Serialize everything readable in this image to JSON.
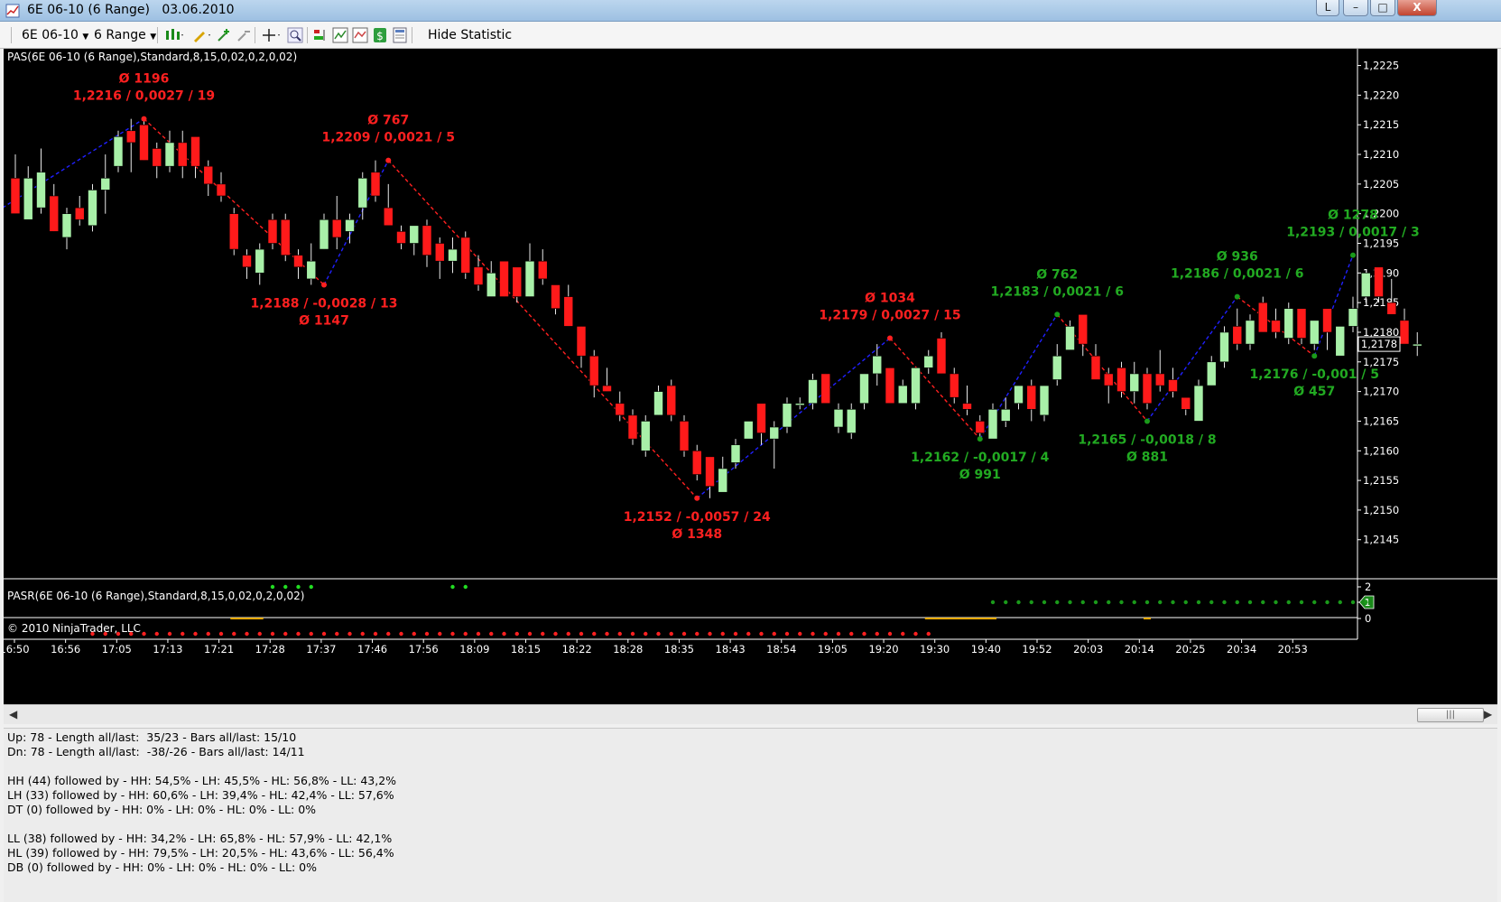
{
  "window": {
    "title": "6E 06-10 (6 Range)",
    "date": "03.06.2010",
    "minimize_label": "–",
    "maximize_label": "□",
    "close_label": "X"
  },
  "toolbar": {
    "instrument": "6E 06-10",
    "period": "6 Range",
    "hide_statistic_label": "Hide Statistic"
  },
  "chart": {
    "indicator_label": "PAS(6E 06-10 (6 Range),Standard,8,15,0,02,0,2,0,02)",
    "subpanel_label": "PASR(6E 06-10 (6 Range),Standard,8,15,0,02,0,2,0,02)",
    "copyright": "© 2010 NinjaTrader, LLC",
    "current_price": "1,2178",
    "subpanel_axis": [
      "2",
      "1",
      "0"
    ],
    "subpanel_value_badge": "1",
    "colors": {
      "up": "#a8f0a8",
      "down": "#ff1a1a",
      "blue_leg": "#2020ff",
      "red_leg": "#ff2020",
      "green_text": "#22aa22"
    }
  },
  "chart_data": {
    "type": "candlestick",
    "ylim": [
      1.2141,
      1.2226
    ],
    "y_ticks": [
      "1,2225",
      "1,2220",
      "1,2215",
      "1,2210",
      "1,2205",
      "1,2200",
      "1,2195",
      "1,2190",
      "1,2185",
      "1,2180",
      "1,2175",
      "1,2170",
      "1,2165",
      "1,2160",
      "1,2155",
      "1,2150",
      "1,2145"
    ],
    "x_ticks": [
      "16:50",
      "16:56",
      "17:05",
      "17:13",
      "17:21",
      "17:28",
      "17:37",
      "17:46",
      "17:56",
      "18:09",
      "18:15",
      "18:22",
      "18:28",
      "18:35",
      "18:43",
      "18:54",
      "19:05",
      "19:20",
      "19:30",
      "19:40",
      "19:52",
      "20:03",
      "20:14",
      "20:25",
      "20:34",
      "20:53"
    ],
    "candles": [
      {
        "o": 1.2206,
        "c": 1.22,
        "h": 1.221,
        "l": 1.22
      },
      {
        "o": 1.2199,
        "c": 1.2206,
        "h": 1.2208,
        "l": 1.2199
      },
      {
        "o": 1.2201,
        "c": 1.2207,
        "h": 1.2211,
        "l": 1.22
      },
      {
        "o": 1.2203,
        "c": 1.2197,
        "h": 1.2205,
        "l": 1.2197
      },
      {
        "o": 1.2196,
        "c": 1.22,
        "h": 1.2201,
        "l": 1.2194
      },
      {
        "o": 1.2201,
        "c": 1.2199,
        "h": 1.2203,
        "l": 1.2198
      },
      {
        "o": 1.2198,
        "c": 1.2204,
        "h": 1.2205,
        "l": 1.2197
      },
      {
        "o": 1.2204,
        "c": 1.2206,
        "h": 1.221,
        "l": 1.22
      },
      {
        "o": 1.2208,
        "c": 1.2213,
        "h": 1.2214,
        "l": 1.2207
      },
      {
        "o": 1.2214,
        "c": 1.2212,
        "h": 1.2216,
        "l": 1.2207
      },
      {
        "o": 1.2215,
        "c": 1.2209,
        "h": 1.2216,
        "l": 1.2209
      },
      {
        "o": 1.2211,
        "c": 1.2208,
        "h": 1.2212,
        "l": 1.2206
      },
      {
        "o": 1.2208,
        "c": 1.2212,
        "h": 1.2214,
        "l": 1.2207
      },
      {
        "o": 1.2212,
        "c": 1.2208,
        "h": 1.2214,
        "l": 1.2206
      },
      {
        "o": 1.2213,
        "c": 1.2208,
        "h": 1.2213,
        "l": 1.2206
      },
      {
        "o": 1.2208,
        "c": 1.2205,
        "h": 1.2209,
        "l": 1.2203
      },
      {
        "o": 1.2205,
        "c": 1.2203,
        "h": 1.2207,
        "l": 1.2202
      },
      {
        "o": 1.22,
        "c": 1.2194,
        "h": 1.2201,
        "l": 1.2193
      },
      {
        "o": 1.2193,
        "c": 1.2191,
        "h": 1.2194,
        "l": 1.2189
      },
      {
        "o": 1.219,
        "c": 1.2194,
        "h": 1.2195,
        "l": 1.2188
      },
      {
        "o": 1.2199,
        "c": 1.2195,
        "h": 1.22,
        "l": 1.2194
      },
      {
        "o": 1.2199,
        "c": 1.2193,
        "h": 1.22,
        "l": 1.2192
      },
      {
        "o": 1.2193,
        "c": 1.2191,
        "h": 1.2194,
        "l": 1.2189
      },
      {
        "o": 1.2189,
        "c": 1.2192,
        "h": 1.2195,
        "l": 1.2188
      },
      {
        "o": 1.2194,
        "c": 1.2199,
        "h": 1.22,
        "l": 1.2194
      },
      {
        "o": 1.2199,
        "c": 1.2196,
        "h": 1.2203,
        "l": 1.2194
      },
      {
        "o": 1.2197,
        "c": 1.2199,
        "h": 1.22,
        "l": 1.2195
      },
      {
        "o": 1.2201,
        "c": 1.2206,
        "h": 1.2207,
        "l": 1.2199
      },
      {
        "o": 1.2207,
        "c": 1.2203,
        "h": 1.2209,
        "l": 1.2202
      },
      {
        "o": 1.2201,
        "c": 1.2198,
        "h": 1.2205,
        "l": 1.2198
      },
      {
        "o": 1.2197,
        "c": 1.2195,
        "h": 1.2198,
        "l": 1.2194
      },
      {
        "o": 1.2195,
        "c": 1.2198,
        "h": 1.2198,
        "l": 1.2193
      },
      {
        "o": 1.2198,
        "c": 1.2193,
        "h": 1.2199,
        "l": 1.2191
      },
      {
        "o": 1.2195,
        "c": 1.2192,
        "h": 1.2196,
        "l": 1.2189
      },
      {
        "o": 1.2192,
        "c": 1.2194,
        "h": 1.2196,
        "l": 1.219
      },
      {
        "o": 1.2196,
        "c": 1.219,
        "h": 1.2197,
        "l": 1.2189
      },
      {
        "o": 1.2191,
        "c": 1.2188,
        "h": 1.2193,
        "l": 1.2187
      },
      {
        "o": 1.2186,
        "c": 1.219,
        "h": 1.2192,
        "l": 1.2186
      },
      {
        "o": 1.2192,
        "c": 1.2186,
        "h": 1.2192,
        "l": 1.2186
      },
      {
        "o": 1.2191,
        "c": 1.2186,
        "h": 1.2191,
        "l": 1.2185
      },
      {
        "o": 1.2186,
        "c": 1.2192,
        "h": 1.2195,
        "l": 1.2186
      },
      {
        "o": 1.2192,
        "c": 1.2189,
        "h": 1.2194,
        "l": 1.2188
      },
      {
        "o": 1.2188,
        "c": 1.2184,
        "h": 1.2188,
        "l": 1.2183
      },
      {
        "o": 1.2186,
        "c": 1.2181,
        "h": 1.2188,
        "l": 1.2181
      },
      {
        "o": 1.2181,
        "c": 1.2176,
        "h": 1.2181,
        "l": 1.2174
      },
      {
        "o": 1.2176,
        "c": 1.2171,
        "h": 1.2177,
        "l": 1.2169
      },
      {
        "o": 1.2171,
        "c": 1.217,
        "h": 1.2174,
        "l": 1.217
      },
      {
        "o": 1.2168,
        "c": 1.2166,
        "h": 1.217,
        "l": 1.2165
      },
      {
        "o": 1.2166,
        "c": 1.2162,
        "h": 1.2167,
        "l": 1.2161
      },
      {
        "o": 1.216,
        "c": 1.2165,
        "h": 1.2166,
        "l": 1.2159
      },
      {
        "o": 1.2166,
        "c": 1.217,
        "h": 1.2171,
        "l": 1.2166
      },
      {
        "o": 1.2171,
        "c": 1.2166,
        "h": 1.2172,
        "l": 1.2165
      },
      {
        "o": 1.2165,
        "c": 1.216,
        "h": 1.2166,
        "l": 1.2159
      },
      {
        "o": 1.216,
        "c": 1.2156,
        "h": 1.2161,
        "l": 1.2155
      },
      {
        "o": 1.2159,
        "c": 1.2154,
        "h": 1.2159,
        "l": 1.2152
      },
      {
        "o": 1.2153,
        "c": 1.2157,
        "h": 1.2159,
        "l": 1.2153
      },
      {
        "o": 1.2158,
        "c": 1.2161,
        "h": 1.2162,
        "l": 1.2157
      },
      {
        "o": 1.2162,
        "c": 1.2165,
        "h": 1.2165,
        "l": 1.2162
      },
      {
        "o": 1.2168,
        "c": 1.2163,
        "h": 1.2168,
        "l": 1.2161
      },
      {
        "o": 1.2162,
        "c": 1.2164,
        "h": 1.2165,
        "l": 1.2157
      },
      {
        "o": 1.2164,
        "c": 1.2168,
        "h": 1.2169,
        "l": 1.2163
      },
      {
        "o": 1.2168,
        "c": 1.2168,
        "h": 1.2169,
        "l": 1.2167
      },
      {
        "o": 1.2168,
        "c": 1.2172,
        "h": 1.2173,
        "l": 1.2167
      },
      {
        "o": 1.2173,
        "c": 1.2168,
        "h": 1.2173,
        "l": 1.2168
      },
      {
        "o": 1.2164,
        "c": 1.2167,
        "h": 1.2168,
        "l": 1.2163
      },
      {
        "o": 1.2163,
        "c": 1.2167,
        "h": 1.2168,
        "l": 1.2162
      },
      {
        "o": 1.2168,
        "c": 1.2173,
        "h": 1.2173,
        "l": 1.2167
      },
      {
        "o": 1.2173,
        "c": 1.2176,
        "h": 1.2178,
        "l": 1.2171
      },
      {
        "o": 1.2174,
        "c": 1.2168,
        "h": 1.2174,
        "l": 1.2168
      },
      {
        "o": 1.2168,
        "c": 1.2171,
        "h": 1.2172,
        "l": 1.2168
      },
      {
        "o": 1.2168,
        "c": 1.2174,
        "h": 1.2174,
        "l": 1.2167
      },
      {
        "o": 1.2174,
        "c": 1.2176,
        "h": 1.2177,
        "l": 1.2173
      },
      {
        "o": 1.2179,
        "c": 1.2173,
        "h": 1.218,
        "l": 1.2173
      },
      {
        "o": 1.2173,
        "c": 1.2169,
        "h": 1.2174,
        "l": 1.2168
      },
      {
        "o": 1.2168,
        "c": 1.2167,
        "h": 1.2171,
        "l": 1.2166
      },
      {
        "o": 1.2165,
        "c": 1.2163,
        "h": 1.2166,
        "l": 1.2162
      },
      {
        "o": 1.2162,
        "c": 1.2167,
        "h": 1.2168,
        "l": 1.2162
      },
      {
        "o": 1.2165,
        "c": 1.2167,
        "h": 1.2169,
        "l": 1.2164
      },
      {
        "o": 1.2168,
        "c": 1.2171,
        "h": 1.2171,
        "l": 1.2167
      },
      {
        "o": 1.2171,
        "c": 1.2167,
        "h": 1.2172,
        "l": 1.2165
      },
      {
        "o": 1.2166,
        "c": 1.2171,
        "h": 1.2171,
        "l": 1.2165
      },
      {
        "o": 1.2172,
        "c": 1.2176,
        "h": 1.2178,
        "l": 1.2171
      },
      {
        "o": 1.2177,
        "c": 1.2181,
        "h": 1.2182,
        "l": 1.2177
      },
      {
        "o": 1.2183,
        "c": 1.2178,
        "h": 1.2183,
        "l": 1.2176
      },
      {
        "o": 1.2176,
        "c": 1.2172,
        "h": 1.2178,
        "l": 1.2172
      },
      {
        "o": 1.2173,
        "c": 1.2171,
        "h": 1.2174,
        "l": 1.2168
      },
      {
        "o": 1.2174,
        "c": 1.217,
        "h": 1.2175,
        "l": 1.2169
      },
      {
        "o": 1.217,
        "c": 1.2173,
        "h": 1.2175,
        "l": 1.2168
      },
      {
        "o": 1.2173,
        "c": 1.2168,
        "h": 1.2174,
        "l": 1.2167
      },
      {
        "o": 1.2173,
        "c": 1.2171,
        "h": 1.2177,
        "l": 1.217
      },
      {
        "o": 1.2172,
        "c": 1.217,
        "h": 1.2174,
        "l": 1.2169
      },
      {
        "o": 1.2169,
        "c": 1.2167,
        "h": 1.2169,
        "l": 1.2166
      },
      {
        "o": 1.2165,
        "c": 1.2171,
        "h": 1.2172,
        "l": 1.2165
      },
      {
        "o": 1.2171,
        "c": 1.2175,
        "h": 1.2176,
        "l": 1.2171
      },
      {
        "o": 1.2175,
        "c": 1.218,
        "h": 1.2181,
        "l": 1.2174
      },
      {
        "o": 1.2181,
        "c": 1.2178,
        "h": 1.2184,
        "l": 1.2177
      },
      {
        "o": 1.2178,
        "c": 1.2182,
        "h": 1.2183,
        "l": 1.2177
      },
      {
        "o": 1.2185,
        "c": 1.218,
        "h": 1.2186,
        "l": 1.218
      },
      {
        "o": 1.2182,
        "c": 1.218,
        "h": 1.2184,
        "l": 1.2179
      },
      {
        "o": 1.2179,
        "c": 1.2184,
        "h": 1.2185,
        "l": 1.2178
      },
      {
        "o": 1.2184,
        "c": 1.2179,
        "h": 1.2184,
        "l": 1.2178
      },
      {
        "o": 1.2178,
        "c": 1.2182,
        "h": 1.2182,
        "l": 1.2177
      },
      {
        "o": 1.2184,
        "c": 1.218,
        "h": 1.2184,
        "l": 1.2177
      },
      {
        "o": 1.2176,
        "c": 1.2181,
        "h": 1.2181,
        "l": 1.2176
      },
      {
        "o": 1.2181,
        "c": 1.2184,
        "h": 1.2186,
        "l": 1.218
      },
      {
        "o": 1.2186,
        "c": 1.219,
        "h": 1.219,
        "l": 1.2185
      },
      {
        "o": 1.2191,
        "c": 1.2186,
        "h": 1.2191,
        "l": 1.2185
      },
      {
        "o": 1.2185,
        "c": 1.2183,
        "h": 1.2189,
        "l": 1.2183
      },
      {
        "o": 1.2182,
        "c": 1.2178,
        "h": 1.2184,
        "l": 1.2178
      },
      {
        "o": 1.2178,
        "c": 1.2178,
        "h": 1.218,
        "l": 1.2176
      }
    ],
    "swing_points": [
      {
        "bar": -1,
        "price": 1.2201
      },
      {
        "bar": 10,
        "price": 1.2216
      },
      {
        "bar": 24,
        "price": 1.2188
      },
      {
        "bar": 29,
        "price": 1.2209
      },
      {
        "bar": 53,
        "price": 1.2152
      },
      {
        "bar": 68,
        "price": 1.2179
      },
      {
        "bar": 75,
        "price": 1.2162
      },
      {
        "bar": 81,
        "price": 1.2183
      },
      {
        "bar": 88,
        "price": 1.2165
      },
      {
        "bar": 95,
        "price": 1.2186
      },
      {
        "bar": 101,
        "price": 1.2176
      },
      {
        "bar": 104,
        "price": 1.2193
      }
    ],
    "annotations": [
      {
        "bar": 10,
        "pos": "above",
        "color": "red",
        "lines": [
          "Ø 1196",
          "1,2216 / 0,0027 / 19"
        ]
      },
      {
        "bar": 29,
        "pos": "above",
        "color": "red",
        "lines": [
          "Ø 767",
          "1,2209 / 0,0021 / 5"
        ]
      },
      {
        "bar": 24,
        "pos": "below",
        "color": "red",
        "lines": [
          "1,2188 / -0,0028 / 13",
          "Ø 1147"
        ]
      },
      {
        "bar": 53,
        "pos": "below",
        "color": "red",
        "lines": [
          "1,2152 / -0,0057 / 24",
          "Ø 1348"
        ]
      },
      {
        "bar": 68,
        "pos": "above",
        "color": "red",
        "lines": [
          "Ø 1034",
          "1,2179 / 0,0027 / 15"
        ]
      },
      {
        "bar": 75,
        "pos": "below",
        "color": "green",
        "lines": [
          "1,2162 / -0,0017 / 4",
          "Ø 991"
        ]
      },
      {
        "bar": 81,
        "pos": "above",
        "color": "green",
        "lines": [
          "Ø 762",
          "1,2183 / 0,0021 / 6"
        ]
      },
      {
        "bar": 88,
        "pos": "below",
        "color": "green",
        "lines": [
          "1,2165 / -0,0018 / 8",
          "Ø 881"
        ]
      },
      {
        "bar": 95,
        "pos": "above",
        "color": "green",
        "lines": [
          "Ø 936",
          "1,2186 / 0,0021 / 6"
        ]
      },
      {
        "bar": 101,
        "pos": "below",
        "color": "green",
        "lines": [
          "1,2176 / -0,001 / 5",
          "Ø 457"
        ]
      },
      {
        "bar": 104,
        "pos": "above",
        "color": "green",
        "lines": [
          "Ø 1278",
          "1,2193 / 0,0017 / 3"
        ]
      }
    ],
    "subpanel": {
      "green_top_bars": [
        20,
        21,
        22,
        23,
        34,
        35
      ],
      "green_bottom_bars": [
        76,
        77,
        78,
        79,
        80,
        81,
        82,
        83,
        84,
        85,
        86,
        87,
        88,
        89,
        90,
        91,
        92,
        93,
        94,
        95,
        96,
        97,
        98,
        99,
        100,
        101,
        102,
        103,
        104,
        105
      ],
      "red_bottom_bars": [
        6,
        7,
        8,
        9,
        10,
        11,
        12,
        13,
        14,
        15,
        16,
        17,
        18,
        19,
        20,
        21,
        22,
        23,
        24,
        25,
        26,
        27,
        28,
        29,
        30,
        31,
        32,
        33,
        34,
        35,
        36,
        37,
        38,
        39,
        40,
        41,
        42,
        43,
        44,
        45,
        46,
        47,
        48,
        49,
        50,
        51,
        52,
        53,
        54,
        55,
        56,
        57,
        58,
        59,
        60,
        61,
        62,
        63,
        64,
        65,
        66,
        67,
        68,
        69,
        70,
        71
      ],
      "orange_segments": [
        [
          17,
          19
        ],
        [
          71,
          76
        ],
        [
          88,
          88
        ]
      ]
    }
  },
  "stats": {
    "lines": [
      "Up: 78 - Length all/last:  35/23 - Bars all/last: 15/10",
      "Dn: 78 - Length all/last:  -38/-26 - Bars all/last: 14/11",
      "",
      "HH (44) followed by - HH: 54,5% - LH: 45,5% - HL: 56,8% - LL: 43,2%",
      "LH (33) followed by - HH: 60,6% - LH: 39,4% - HL: 42,4% - LL: 57,6%",
      "DT (0) followed by - HH: 0% - LH: 0% - HL: 0% - LL: 0%",
      "",
      "LL (38) followed by - HH: 34,2% - LH: 65,8% - HL: 57,9% - LL: 42,1%",
      "HL (39) followed by - HH: 79,5% - LH: 20,5% - HL: 43,6% - LL: 56,4%",
      "DB (0) followed by - HH: 0% - LH: 0% - HL: 0% - LL: 0%"
    ]
  },
  "scroll": {
    "thumb_grip": "|||"
  }
}
